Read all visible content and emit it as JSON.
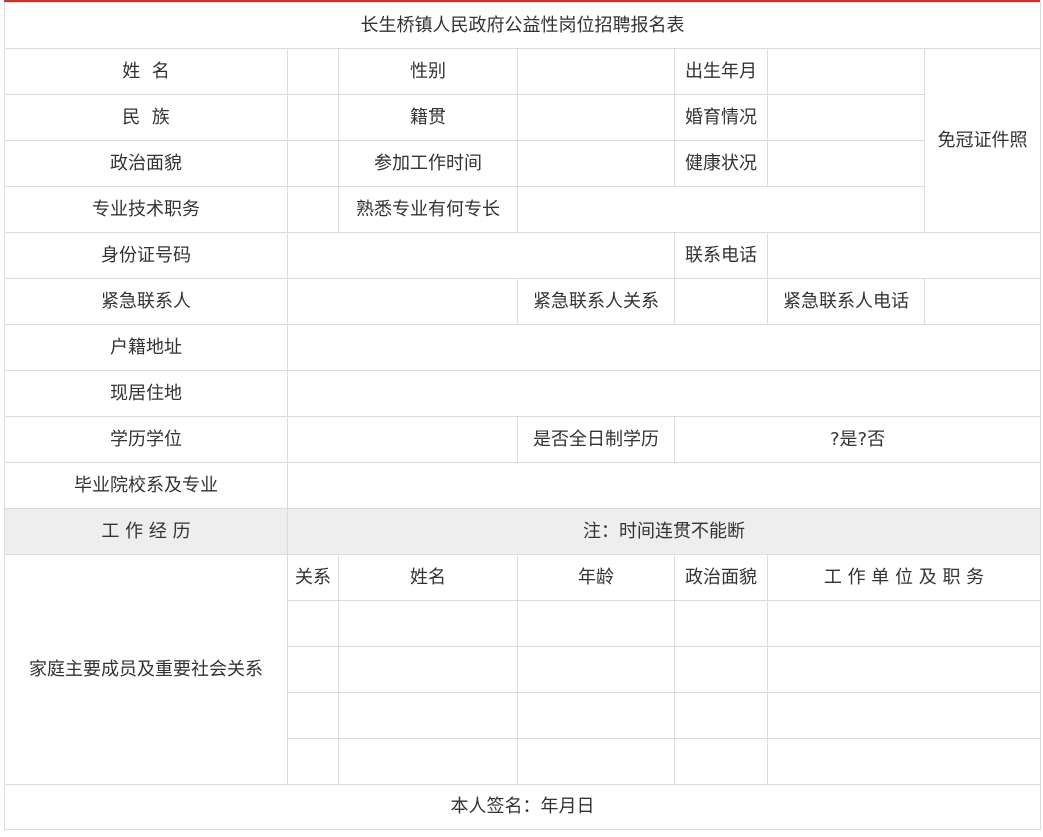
{
  "title": "长生桥镇人民政府公益性岗位招聘报名表",
  "labels": {
    "name": "姓  名",
    "gender": "性别",
    "birth": "出生年月",
    "photo": "免冠证件照",
    "ethnicity": "民  族",
    "native_place": "籍贯",
    "marital": "婚育情况",
    "political": "政治面貌",
    "work_start": "参加工作时间",
    "health": "健康状况",
    "title_prof": "专业技术职务",
    "specialty": "熟悉专业有何专长",
    "id_number": "身份证号码",
    "phone": "联系电话",
    "emergency_contact": "紧急联系人",
    "emergency_relation": "紧急联系人关系",
    "emergency_phone": "紧急联系人电话",
    "household_address": "户籍地址",
    "current_address": "现居住地",
    "education": "学历学位",
    "fulltime": "是否全日制学历",
    "fulltime_choice": "?是?否",
    "school_major": "毕业院校系及专业",
    "work_history": "工 作 经 历",
    "work_history_note": "注：时间连贯不能断",
    "family": "家庭主要成员及重要社会关系",
    "signature": "本人签名：年月日"
  },
  "family_table": {
    "headers": [
      "关系",
      "姓名",
      "年龄",
      "政治面貌",
      "工 作 单 位 及 职 务"
    ],
    "rows": [
      [
        "",
        "",
        "",
        "",
        ""
      ],
      [
        "",
        "",
        "",
        "",
        ""
      ],
      [
        "",
        "",
        "",
        "",
        ""
      ],
      [
        "",
        "",
        "",
        "",
        ""
      ]
    ]
  },
  "colors": {
    "accent_line": "#c0392b",
    "border": "#dcdcdc",
    "shaded_row": "#eeeeee",
    "text": "#333333"
  }
}
